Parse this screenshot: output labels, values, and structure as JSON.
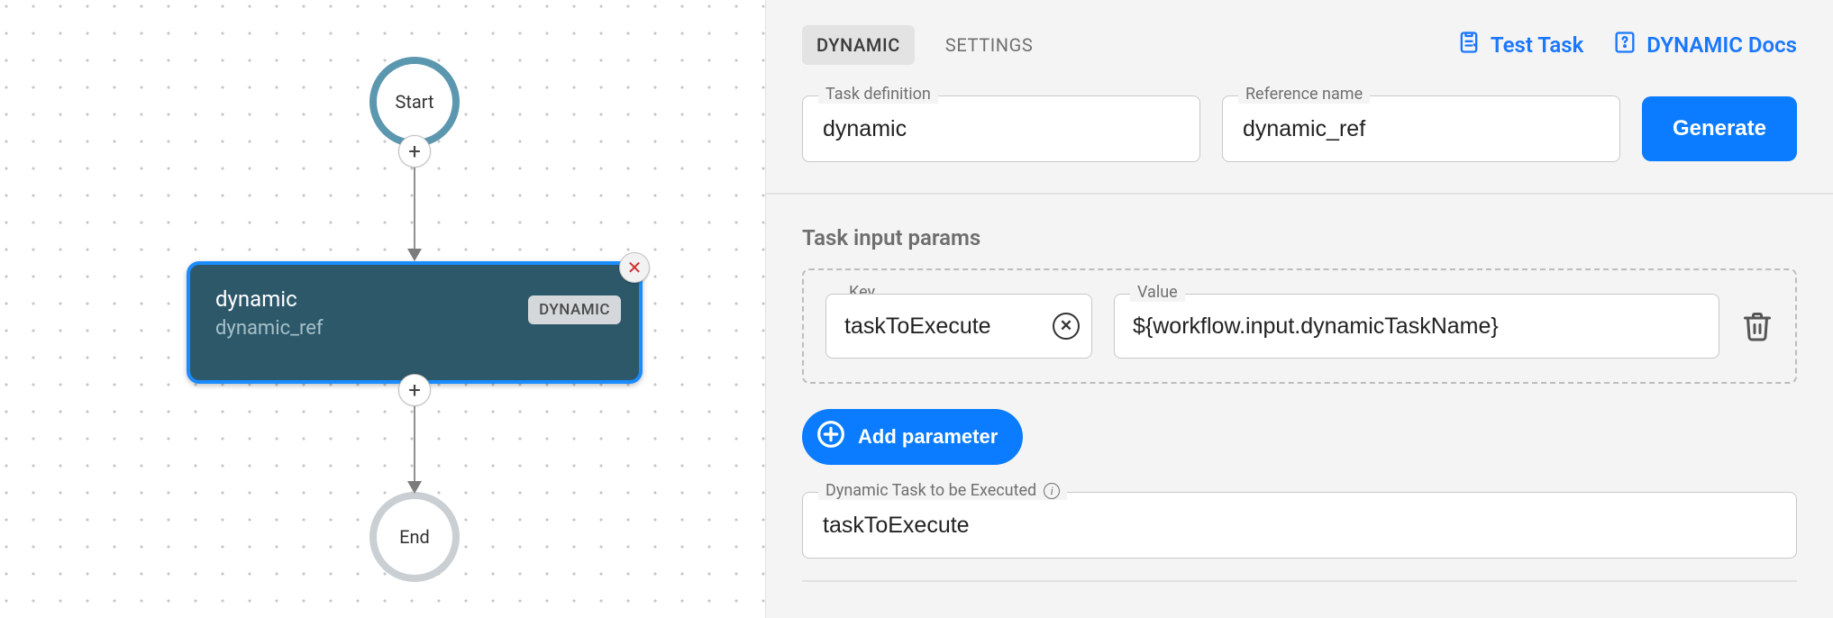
{
  "canvas": {
    "start_label": "Start",
    "end_label": "End",
    "task_title": "dynamic",
    "task_subtitle": "dynamic_ref",
    "task_badge": "DYNAMIC"
  },
  "tabs": {
    "dynamic": "DYNAMIC",
    "settings": "SETTINGS"
  },
  "header_links": {
    "test_task": "Test Task",
    "docs": "DYNAMIC Docs"
  },
  "task_def": {
    "label": "Task definition",
    "value": "dynamic"
  },
  "ref_name": {
    "label": "Reference name",
    "value": "dynamic_ref"
  },
  "generate_label": "Generate",
  "params_title": "Task input params",
  "param_row": {
    "key_label": "Key",
    "key_value": "taskToExecute",
    "value_label": "Value",
    "value_value": "${workflow.input.dynamicTaskName}"
  },
  "add_param_label": "Add parameter",
  "dyn_exec": {
    "label": "Dynamic Task to be Executed",
    "value": "taskToExecute"
  }
}
